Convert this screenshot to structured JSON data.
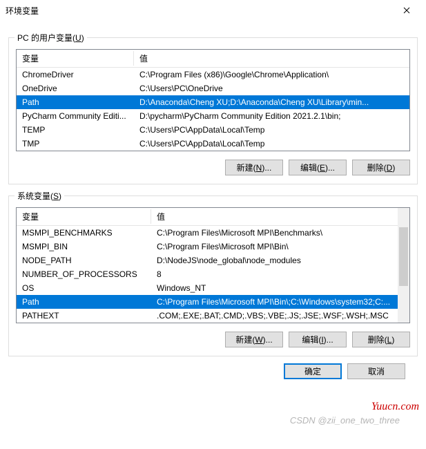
{
  "window": {
    "title": "环境变量"
  },
  "user_vars": {
    "label": "PC 的用户变量(U)",
    "headers": {
      "name": "变量",
      "value": "值"
    },
    "rows": [
      {
        "name": "ChromeDriver",
        "value": "C:\\Program Files (x86)\\Google\\Chrome\\Application\\"
      },
      {
        "name": "OneDrive",
        "value": "C:\\Users\\PC\\OneDrive"
      },
      {
        "name": "Path",
        "value": "D:\\Anaconda\\Cheng XU;D:\\Anaconda\\Cheng XU\\Library\\min...",
        "selected": true
      },
      {
        "name": "PyCharm Community Editi...",
        "value": "D:\\pycharm\\PyCharm Community Edition 2021.2.1\\bin;"
      },
      {
        "name": "TEMP",
        "value": "C:\\Users\\PC\\AppData\\Local\\Temp"
      },
      {
        "name": "TMP",
        "value": "C:\\Users\\PC\\AppData\\Local\\Temp"
      }
    ],
    "buttons": {
      "new": "新建(N)...",
      "edit": "编辑(E)...",
      "delete": "删除(D)"
    }
  },
  "system_vars": {
    "label": "系统变量(S)",
    "headers": {
      "name": "变量",
      "value": "值"
    },
    "rows": [
      {
        "name": "MSMPI_BENCHMARKS",
        "value": "C:\\Program Files\\Microsoft MPI\\Benchmarks\\"
      },
      {
        "name": "MSMPI_BIN",
        "value": "C:\\Program Files\\Microsoft MPI\\Bin\\"
      },
      {
        "name": "NODE_PATH",
        "value": "D:\\NodeJS\\node_global\\node_modules"
      },
      {
        "name": "NUMBER_OF_PROCESSORS",
        "value": "8"
      },
      {
        "name": "OS",
        "value": "Windows_NT"
      },
      {
        "name": "Path",
        "value": "C:\\Program Files\\Microsoft MPI\\Bin\\;C:\\Windows\\system32;C:...",
        "selected": true
      },
      {
        "name": "PATHEXT",
        "value": ".COM;.EXE;.BAT;.CMD;.VBS;.VBE;.JS;.JSE;.WSF;.WSH;.MSC"
      }
    ],
    "buttons": {
      "new": "新建(W)...",
      "edit": "编辑(I)...",
      "delete": "删除(L)"
    }
  },
  "footer": {
    "ok": "确定",
    "cancel": "取消"
  },
  "watermarks": {
    "site": "Yuucn.com",
    "csdn": "CSDN @zii_one_two_three"
  }
}
